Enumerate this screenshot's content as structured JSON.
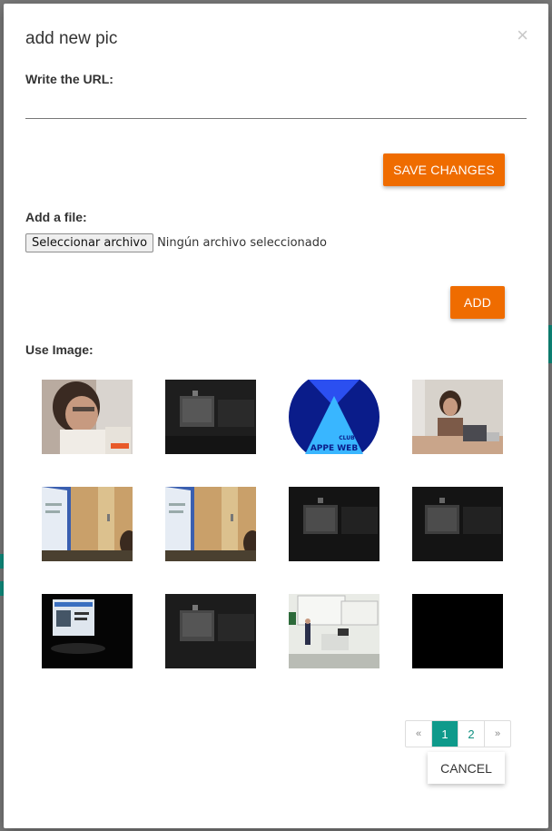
{
  "modal": {
    "title": "add new pic",
    "close_glyph": "×"
  },
  "url_section": {
    "label": "Write the URL:",
    "value": "",
    "save_label": "SAVE CHANGES"
  },
  "file_section": {
    "label": "Add a file:",
    "choose_button": "Seleccionar archivo",
    "status": "Ningún archivo seleccionado",
    "add_label": "ADD"
  },
  "images_section": {
    "label": "Use Image:",
    "thumbnails": [
      {
        "name": "thumb-woman-phone"
      },
      {
        "name": "thumb-dark-room"
      },
      {
        "name": "thumb-appe-web-logo",
        "logo_text_1": "APPE WEB",
        "logo_text_2": "CLUB"
      },
      {
        "name": "thumb-speaker-laptop"
      },
      {
        "name": "thumb-poster-room"
      },
      {
        "name": "thumb-poster-room"
      },
      {
        "name": "thumb-dark-room"
      },
      {
        "name": "thumb-dark-room"
      },
      {
        "name": "thumb-projector-screen"
      },
      {
        "name": "thumb-dark-room"
      },
      {
        "name": "thumb-lecture-hall"
      },
      {
        "name": "thumb-black"
      }
    ]
  },
  "pagination": {
    "prev": "«",
    "pages": [
      "1",
      "2"
    ],
    "active_page": "1",
    "next": "»"
  },
  "cancel_label": "CANCEL",
  "colors": {
    "accent_orange": "#ef6c00",
    "accent_teal": "#0f9a8b"
  }
}
